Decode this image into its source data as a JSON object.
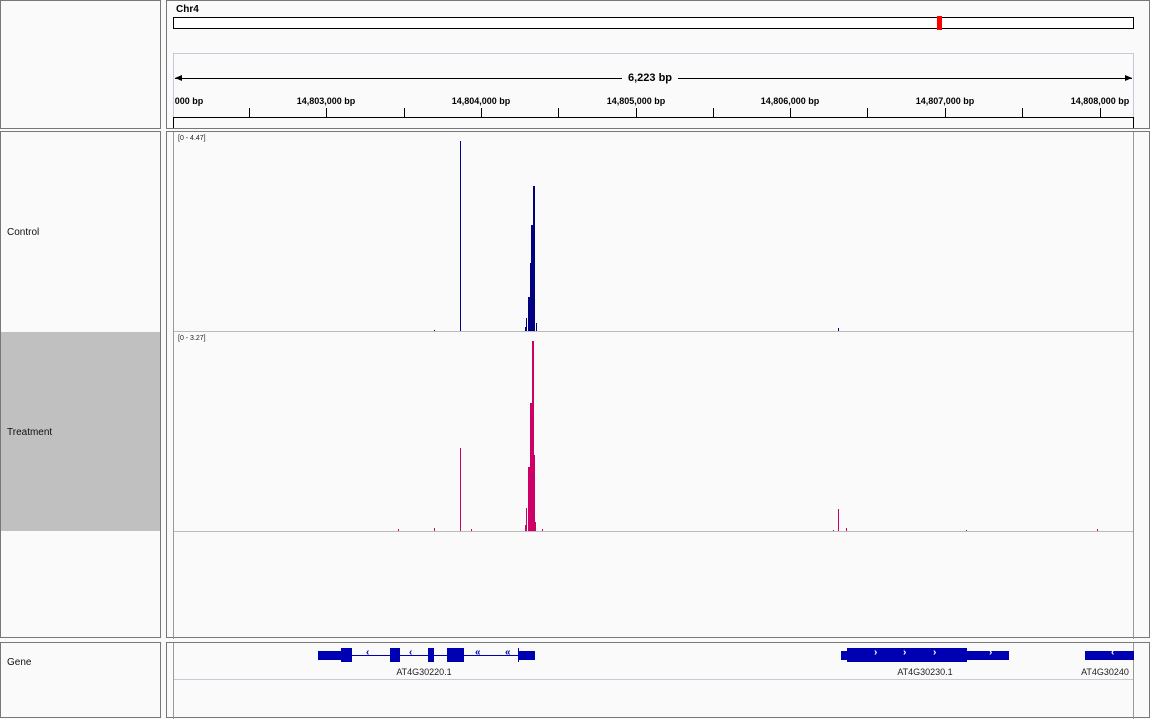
{
  "header": {
    "chromosome": "Chr4",
    "span_label": "6,223 bp",
    "ideogram_marker_color": "#ff0000",
    "ruler_labels": [
      "000 bp",
      "14,803,000 bp",
      "14,804,000 bp",
      "14,805,000 bp",
      "14,806,000 bp",
      "14,807,000 bp",
      "14,808,000 bp"
    ]
  },
  "tracks": [
    {
      "name": "Control",
      "range": "[0 - 4.47]",
      "max": 4.47,
      "color": "#000080",
      "selected": false,
      "peaks": [
        [
          14803700,
          0.03
        ],
        [
          14803868,
          4.47
        ],
        [
          14804290,
          0.1
        ],
        [
          14804300,
          0.3
        ],
        [
          14804310,
          0.8
        ],
        [
          14804320,
          1.6
        ],
        [
          14804330,
          2.5
        ],
        [
          14804340,
          3.41
        ],
        [
          14804350,
          1.2
        ],
        [
          14804360,
          0.2
        ],
        [
          14806320,
          0.06
        ]
      ]
    },
    {
      "name": "Treatment",
      "range": "[0 - 3.27]",
      "max": 3.27,
      "color": "#cc0066",
      "selected": true,
      "peaks": [
        [
          14803470,
          0.03
        ],
        [
          14803700,
          0.05
        ],
        [
          14803868,
          1.43
        ],
        [
          14803940,
          0.03
        ],
        [
          14804290,
          0.1
        ],
        [
          14804300,
          0.4
        ],
        [
          14804310,
          1.1
        ],
        [
          14804320,
          2.2
        ],
        [
          14804333,
          3.27
        ],
        [
          14804343,
          1.3
        ],
        [
          14804355,
          0.15
        ],
        [
          14804400,
          0.03
        ],
        [
          14806290,
          0.02
        ],
        [
          14806320,
          0.38
        ],
        [
          14806370,
          0.05
        ],
        [
          14807150,
          0.02
        ],
        [
          14808000,
          0.03
        ]
      ]
    }
  ],
  "gene_track": {
    "name": "Gene",
    "color": "#0000b3",
    "genes": [
      "AT4G30220.1",
      "AT4G30230.1",
      "AT4G30240"
    ]
  }
}
